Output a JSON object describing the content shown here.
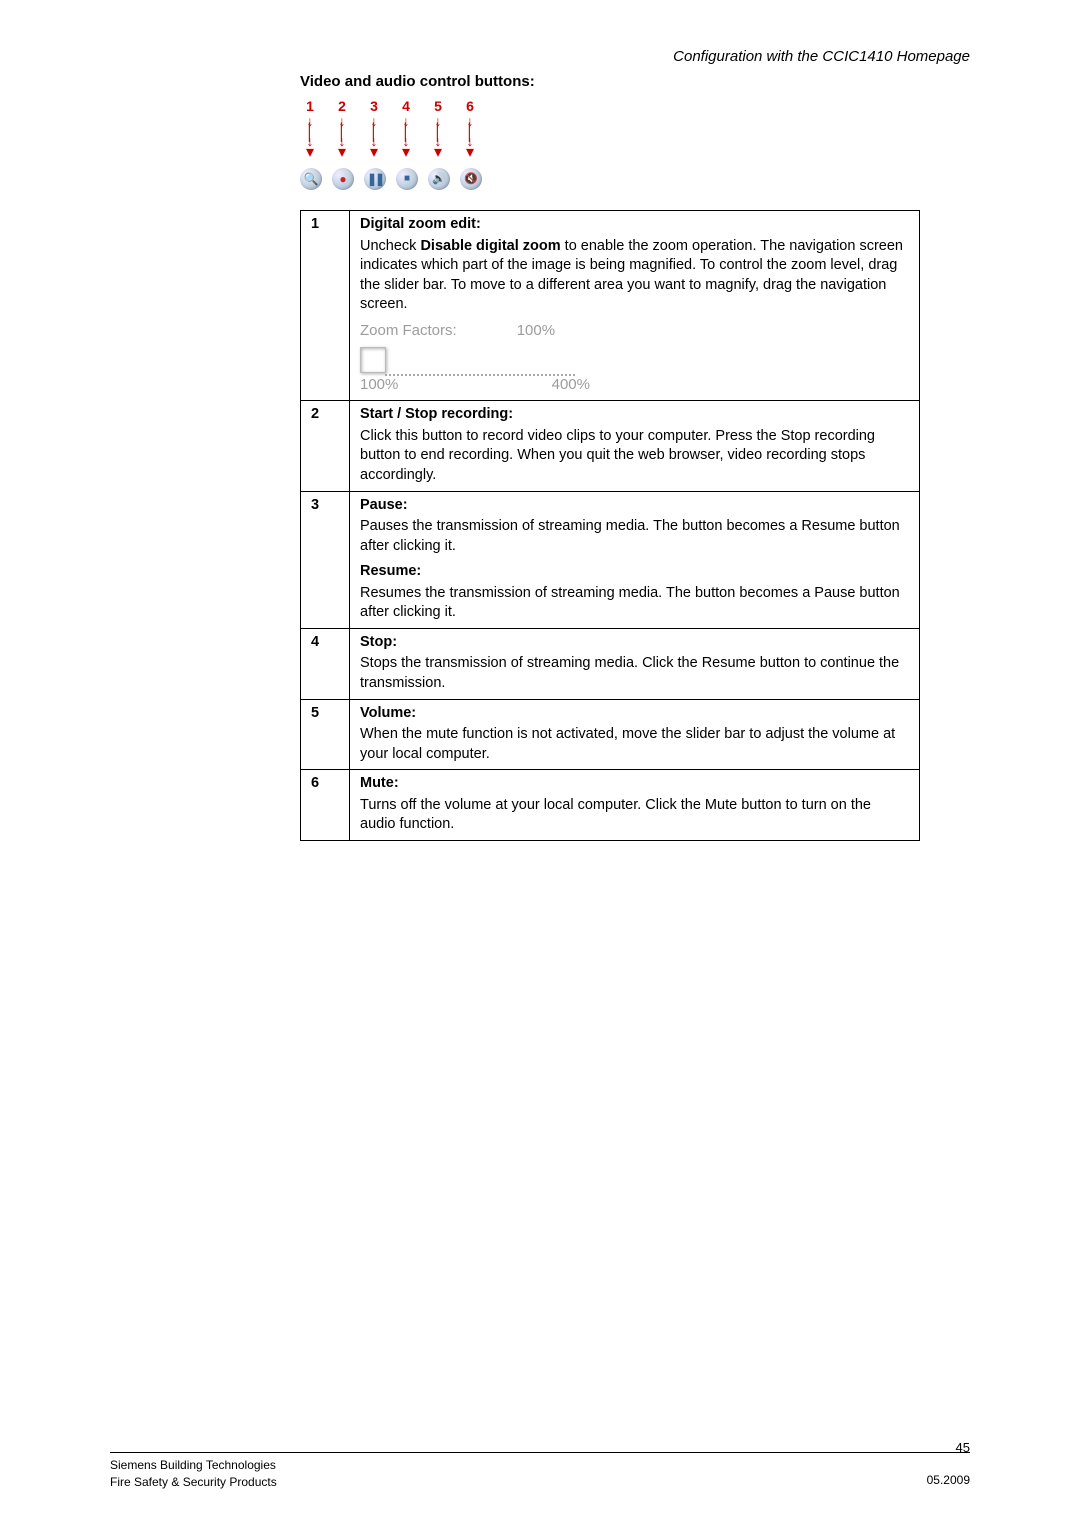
{
  "header": {
    "title": "Configuration with the CCIC1410 Homepage"
  },
  "section": {
    "title": "Video and audio control buttons:"
  },
  "callouts": [
    "1",
    "2",
    "3",
    "4",
    "5",
    "6"
  ],
  "icons": {
    "zoom": "zoom-icon",
    "record": "record-icon",
    "pause": "pause-icon",
    "stop": "stop-icon",
    "volume": "volume-icon",
    "mute": "mute-icon"
  },
  "rows": [
    {
      "num": "1",
      "title": "Digital zoom edit:",
      "pre_bold": "Uncheck ",
      "bold": "Disable digital zoom",
      "post_bold": " to enable the zoom operation. The navigation screen indicates which part of the image is being magnified. To control the zoom level, drag the slider bar. To move to a different area you want to magnify, drag the navigation screen.",
      "zoom": {
        "label": "Zoom Factors:",
        "value": "100%",
        "min": "100%",
        "max": "400%"
      }
    },
    {
      "num": "2",
      "title": "Start / Stop recording:",
      "body": "Click this button to record video clips to your computer. Press the Stop recording button to end recording. When you quit the web browser, video recording stops accordingly."
    },
    {
      "num": "3",
      "title": "Pause:",
      "body": "Pauses the transmission of streaming media. The button becomes a Resume button after clicking it.",
      "title2": "Resume:",
      "body2": "Resumes the transmission of streaming media. The button becomes a Pause button after clicking it."
    },
    {
      "num": "4",
      "title": "Stop:",
      "body": "Stops the transmission of streaming media. Click the Resume button to continue the transmission."
    },
    {
      "num": "5",
      "title": "Volume:",
      "body": "When the mute function is not activated, move the slider bar to adjust the volume at your local computer."
    },
    {
      "num": "6",
      "title": "Mute:",
      "body": "Turns off the volume at your local computer. Click the Mute button to turn on the audio function.",
      "title_sep": ":"
    }
  ],
  "footer": {
    "page": "45",
    "left1": "Siemens Building Technologies",
    "left2": "Fire Safety & Security Products",
    "right": "05.2009"
  }
}
